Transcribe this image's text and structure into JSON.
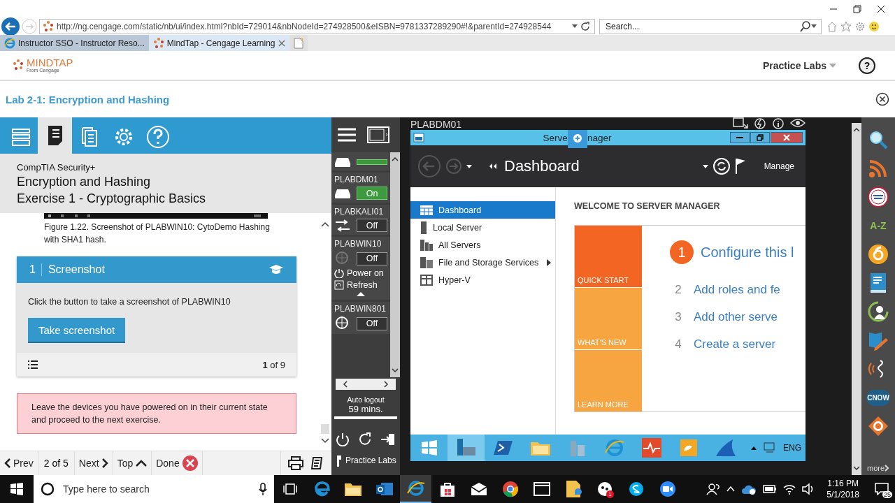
{
  "browser": {
    "address": "http://ng.cengage.com/static/nb/ui/index.html?nbId=729014&nbNodeId=274928500&eISBN=9781337289290#!&parentId=274928544",
    "search": {
      "placeholder": "Search..."
    },
    "tabs": [
      {
        "label": "Instructor SSO - Instructor Reso...",
        "kind": "ie",
        "selected": false
      },
      {
        "label": "MindTap - Cengage Learning",
        "kind": "mindtap",
        "selected": true
      }
    ]
  },
  "app_header": {
    "logo": "MINDTAP",
    "logo_sub": "From Cengage",
    "menu": "Practice Labs",
    "help": "?"
  },
  "lab": {
    "title": "Lab 2-1: Encryption and Hashing"
  },
  "panel": {
    "tools": [
      {
        "kind": "archive",
        "selected": false
      },
      {
        "kind": "notes",
        "selected": true
      },
      {
        "kind": "docs",
        "selected": false
      },
      {
        "kind": "settings",
        "selected": false
      },
      {
        "kind": "help",
        "selected": false
      }
    ],
    "course": "CompTIA Security+",
    "topic": "Encryption and Hashing",
    "exercise": "Exercise 1 - Cryptographic Basics",
    "figure_caption": "Figure 1.22. Screenshot of PLABWIN10: CytoDemo Hashing with SHA1 hash.",
    "step": {
      "number": "1",
      "title": "Screenshot",
      "instruction": "Click the button to take a screenshot of PLABWIN10",
      "button": "Take screenshot",
      "counter": "**1** of 9"
    },
    "alert": "Leave the devices you have powered on in their current state and proceed to the next exercise.",
    "nav": [
      {
        "kind": "prev",
        "label": "Prev"
      },
      {
        "kind": "text",
        "label": "2 of 5"
      },
      {
        "kind": "next",
        "label": "Next"
      },
      {
        "kind": "top",
        "label": "Top"
      },
      {
        "kind": "done",
        "label": "Done"
      }
    ]
  },
  "devices": [
    {
      "kind": "server",
      "on": true
    },
    {
      "name": "PLABDM01",
      "kind": "server",
      "on": true,
      "state": "On"
    },
    {
      "name": "PLABKALI01",
      "kind": "network",
      "on": false,
      "state": "Off"
    },
    {
      "name": "PLABWIN10",
      "kind": "windows-dim",
      "on": false,
      "state": "Off",
      "actions": [
        {
          "kind": "power",
          "label": "Power on"
        },
        {
          "kind": "refresh",
          "label": "Refresh"
        }
      ]
    },
    {
      "name": "PLABWIN801",
      "kind": "windows",
      "on": false,
      "state": "Off"
    }
  ],
  "session": {
    "label": "Auto logout",
    "remaining": "59 mins.",
    "level": 1,
    "brand": "Practice Labs"
  },
  "vm": {
    "name": "PLABDM01",
    "window": {
      "title_parts": [
        "Serve",
        "nager"
      ],
      "page": "Dashboard",
      "manage": "Manage",
      "nav": [
        {
          "label": "Dashboard",
          "kind": "dashboard",
          "selected": true
        },
        {
          "label": "Local Server",
          "kind": "server",
          "selected": false
        },
        {
          "label": "All Servers",
          "kind": "servers",
          "selected": false
        },
        {
          "label": "File and Storage Services",
          "kind": "storage",
          "selected": false,
          "submenu": true
        },
        {
          "label": "Hyper-V",
          "kind": "hyperv",
          "selected": false
        }
      ],
      "welcome": "WELCOME TO SERVER MANAGER",
      "tiles": [
        {
          "label": "QUICK START",
          "color": "#f26522"
        },
        {
          "label": "WHAT'S NEW",
          "color": "#f7a540"
        },
        {
          "label": "LEARN MORE",
          "color": "#f7a540"
        }
      ],
      "steps": [
        {
          "number": "1",
          "label": "Configure this l",
          "current": true
        },
        {
          "number": "2",
          "label": "Add roles and fe",
          "current": false
        },
        {
          "number": "3",
          "label": "Add other serve",
          "current": false
        },
        {
          "number": "4",
          "label": "Create a server",
          "current": false
        }
      ]
    },
    "taskbar": {
      "apps": [
        {
          "kind": "start"
        },
        {
          "kind": "servermanager",
          "selected": true
        },
        {
          "kind": "powershell"
        },
        {
          "kind": "folder"
        },
        {
          "kind": "tools"
        },
        {
          "kind": "ie"
        },
        {
          "kind": "monitor"
        },
        {
          "kind": "paint"
        },
        {
          "kind": "shark"
        }
      ],
      "language": "ENG"
    }
  },
  "sidebar": {
    "tools": [
      {
        "kind": "search"
      },
      {
        "kind": "rss"
      },
      {
        "kind": "dictionary"
      },
      {
        "kind": "az",
        "label": "A-Z"
      },
      {
        "kind": "six"
      },
      {
        "kind": "book"
      },
      {
        "kind": "person"
      },
      {
        "kind": "map"
      },
      {
        "kind": "audio"
      },
      {
        "kind": "cnow",
        "label": "CNOW"
      },
      {
        "kind": "badge"
      }
    ],
    "more": "more"
  },
  "taskbar": {
    "search_placeholder": "Type here to search",
    "apps": [
      {
        "kind": "taskview",
        "selected": false
      },
      {
        "kind": "edge",
        "selected": false
      },
      {
        "kind": "explorer",
        "selected": false
      },
      {
        "kind": "outlook",
        "selected": false
      },
      {
        "kind": "ie",
        "selected": true
      },
      {
        "kind": "store",
        "selected": false
      },
      {
        "kind": "mail",
        "selected": false
      },
      {
        "kind": "chrome",
        "selected": false
      },
      {
        "kind": "window",
        "selected": false
      },
      {
        "kind": "files",
        "selected": false
      },
      {
        "kind": "chat",
        "selected": false,
        "badge": "1"
      },
      {
        "kind": "skype",
        "selected": false
      },
      {
        "kind": "video",
        "selected": false
      }
    ],
    "time": "1:16 PM",
    "date": "5/1/2018",
    "notifications": "25"
  }
}
